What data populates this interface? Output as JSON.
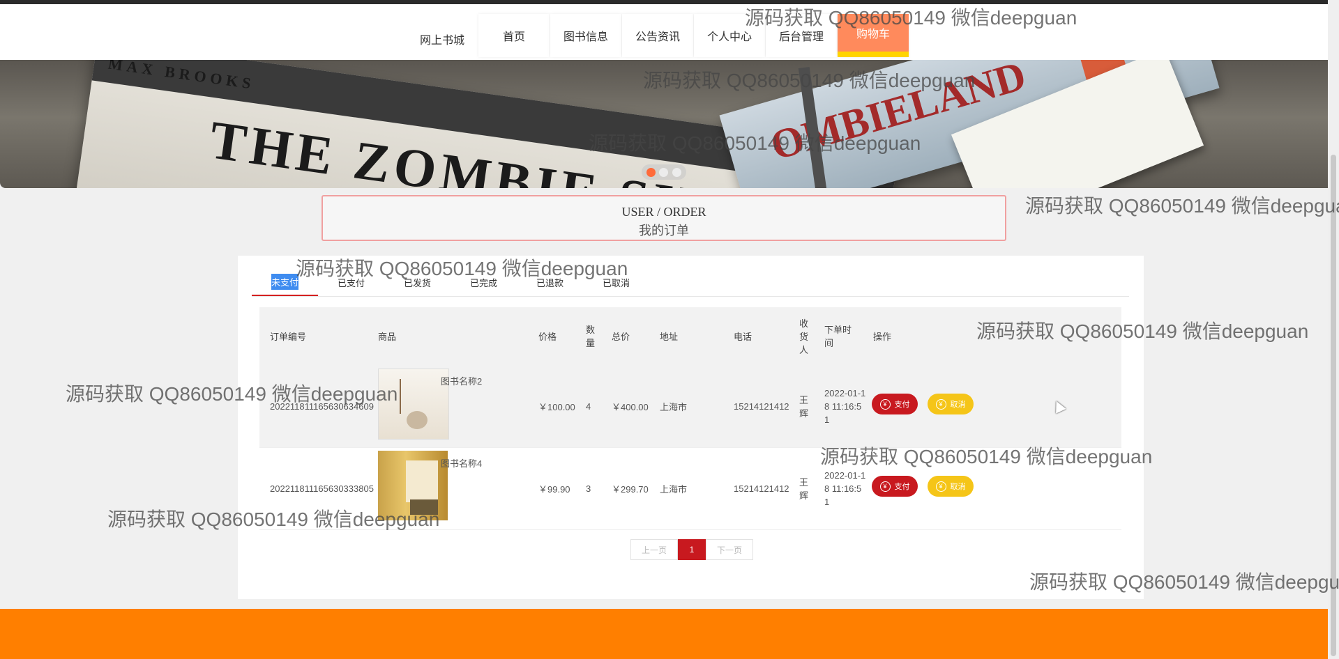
{
  "header": {
    "site_name": "网上书城",
    "nav": [
      {
        "label": "首页"
      },
      {
        "label": "图书信息"
      },
      {
        "label": "公告资讯"
      },
      {
        "label": "个人中心"
      },
      {
        "label": "后台管理"
      },
      {
        "label": "购物车",
        "active": true
      }
    ]
  },
  "banner": {
    "book_text_main": "THE ZOMBIE SURVIV",
    "book_text_author": "MAX BROOKS",
    "book_text_top": "OMBIELAND",
    "slide_count": 3,
    "active_slide": 1
  },
  "section": {
    "title_en": "USER / ORDER",
    "title_cn": "我的订单"
  },
  "tabs": [
    {
      "label": "未支付",
      "active": true
    },
    {
      "label": "已支付"
    },
    {
      "label": "已发货"
    },
    {
      "label": "已完成"
    },
    {
      "label": "已退款"
    },
    {
      "label": "已取消"
    }
  ],
  "table": {
    "headers": {
      "order_no": "订单编号",
      "product": "商品",
      "price": "价格",
      "qty": "数量",
      "total": "总价",
      "address": "地址",
      "phone": "电话",
      "receiver": "收货人",
      "time": "下单时间",
      "action": "操作"
    },
    "rows": [
      {
        "order_no": "20221181116563063460​9",
        "product_name": "图书名称2",
        "price": "￥100.00",
        "qty": "4",
        "total": "￥400.00",
        "address": "上海市",
        "phone": "15214121412",
        "receiver": "王辉",
        "time": "2022-01-18 11:16:51",
        "pay_label": "支付",
        "cancel_label": "取消"
      },
      {
        "order_no": "20221181116563033380​5",
        "product_name": "图书名称4",
        "price": "￥99.90",
        "qty": "3",
        "total": "￥299.70",
        "address": "上海市",
        "phone": "15214121412",
        "receiver": "王辉",
        "time": "2022-01-18 11:16:51",
        "pay_label": "支付",
        "cancel_label": "取消"
      }
    ]
  },
  "pager": {
    "prev": "上一页",
    "current": "1",
    "next": "下一页"
  },
  "watermark_text": "源码获取 QQ86050149 微信deepguan",
  "colors": {
    "accent": "#c8191f",
    "nav_active": "#ff8a5c",
    "footer": "#ff7f00",
    "cancel": "#f5c518"
  }
}
